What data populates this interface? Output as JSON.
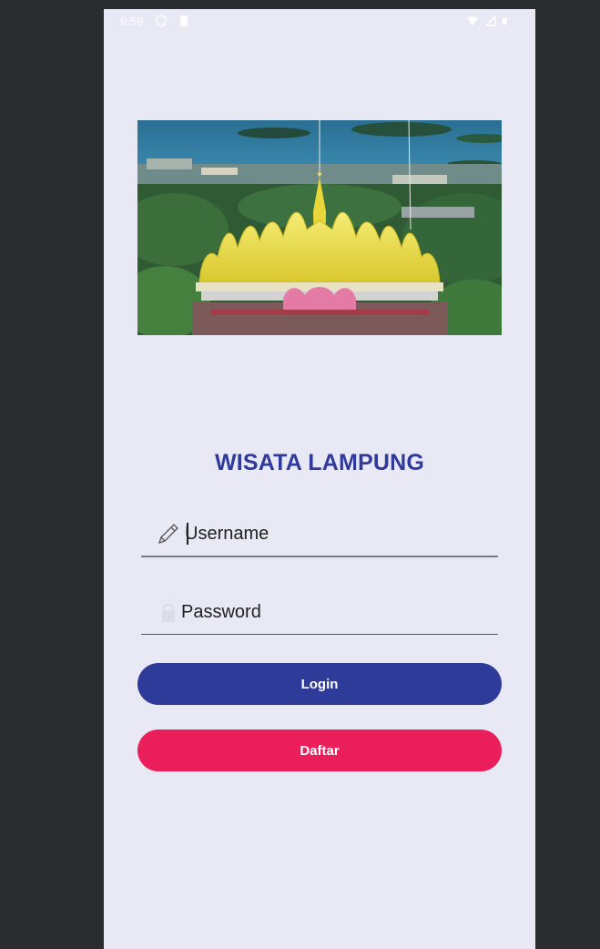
{
  "statusbar": {
    "time": "9:59",
    "icons": [
      "shield-icon",
      "sim-card-icon",
      "wifi-icon",
      "signal-icon",
      "battery-icon"
    ]
  },
  "hero": {
    "description_icon": "landmark-photo"
  },
  "app": {
    "title": "WISATA LAMPUNG"
  },
  "form": {
    "username": {
      "placeholder": "Username",
      "value": "",
      "icon": "pencil-icon"
    },
    "password": {
      "placeholder": "Password",
      "value": "",
      "icon": "lock-icon"
    }
  },
  "buttons": {
    "login_label": "Login",
    "daftar_label": "Daftar"
  },
  "colors": {
    "background": "#e9e9f6",
    "title": "#2f3a9a",
    "login": "#2f3b99",
    "daftar": "#e91e5a"
  }
}
